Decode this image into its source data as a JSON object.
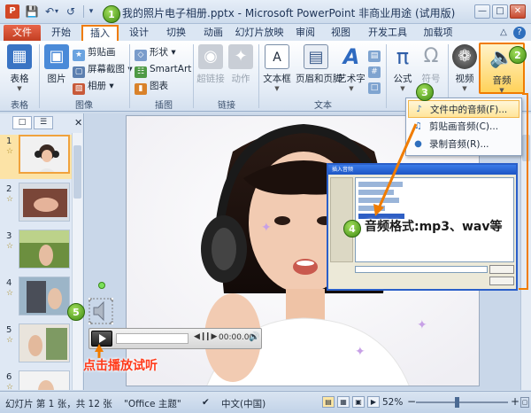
{
  "titlebar": {
    "app_icon": "P",
    "title": "我的照片电子相册.pptx - Microsoft PowerPoint 非商业用途 (试用版)",
    "icons": [
      "save-icon",
      "undo-icon",
      "redo-icon",
      "customize-qat-icon",
      "minimize-icon",
      "maximize-icon",
      "close-icon"
    ]
  },
  "tabs": [
    "文件",
    "开始",
    "插入",
    "设计",
    "切换",
    "动画",
    "幻灯片放映",
    "审阅",
    "视图",
    "开发工具",
    "加载项"
  ],
  "ribbon": {
    "tables": {
      "btn": "表格",
      "group": "表格"
    },
    "images": {
      "picture": "图片",
      "clipart": "剪贴画",
      "screenshot": "屏幕截图",
      "album": "相册",
      "group": "图像"
    },
    "illustrations": {
      "shapes": "形状",
      "smartart": "SmartArt",
      "chart": "图表",
      "group": "插图"
    },
    "links": {
      "hyperlink": "超链接",
      "action": "动作",
      "group": "链接"
    },
    "text": {
      "textbox": "文本框",
      "header_footer": "页眉和页脚",
      "wordart": "艺术字",
      "group": "文本"
    },
    "symbols": {
      "equation": "公式",
      "symbol": "符号"
    },
    "media": {
      "video": "视频",
      "audio": "音频"
    }
  },
  "audio_menu": [
    "文件中的音频(F)...",
    "剪贴画音频(C)...",
    "录制音频(R)..."
  ],
  "slides": {
    "numbers": [
      "1",
      "2",
      "3",
      "4",
      "5",
      "6"
    ],
    "active": 1
  },
  "dialog": {
    "title": "插入音频"
  },
  "media_bar": {
    "time": "00:00.00"
  },
  "callouts": {
    "format": "音频格式:mp3、wav等",
    "play": "点击播放试听",
    "steps": [
      "1",
      "2",
      "3",
      "4",
      "5"
    ]
  },
  "statusbar": {
    "slide": "幻灯片 第 1 张，共 12 张",
    "theme": "\"Office 主题\"",
    "lang": "中文(中国)",
    "zoom": "52%"
  },
  "colors": {
    "accent": "#f07c00",
    "file_tab": "#c23f22",
    "step_badge": "#3d8a12",
    "play_text": "#ff3a1a"
  }
}
